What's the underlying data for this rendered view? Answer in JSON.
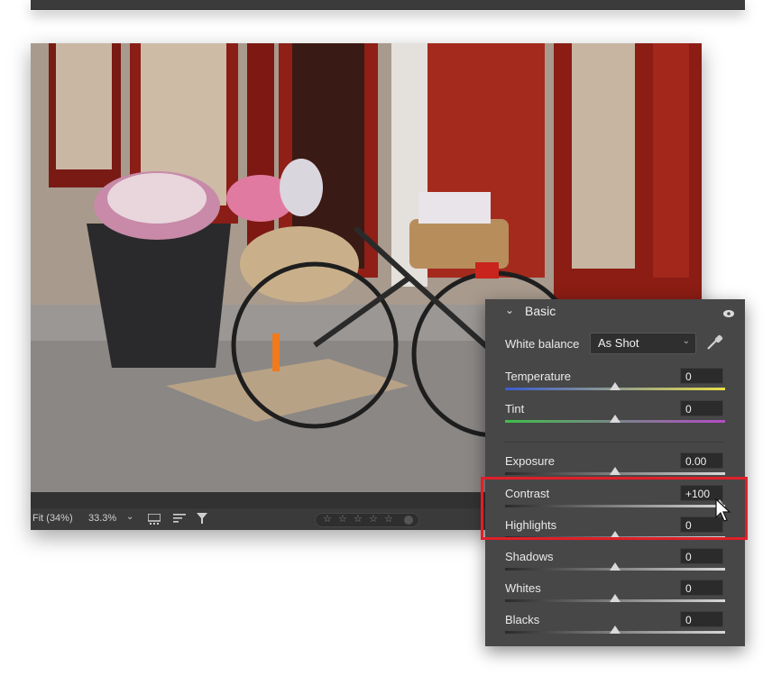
{
  "status_bar": {
    "fit_label": "Fit (34%)",
    "zoom_label": "33.3%",
    "zoom_caret": "⌄",
    "rating_stars": [
      "☆",
      "☆",
      "☆",
      "☆",
      "☆"
    ]
  },
  "basic_panel": {
    "title": "Basic",
    "chevron": "⌄",
    "white_balance_label": "White balance",
    "white_balance_value": "As Shot",
    "white_balance_caret": "⌄",
    "sliders": [
      {
        "label": "Temperature",
        "value": "0",
        "level": 0.5
      },
      {
        "label": "Tint",
        "value": "0",
        "level": 0.5
      },
      {
        "label": "Exposure",
        "value": "0.00",
        "level": 0.5
      },
      {
        "label": "Contrast",
        "value": "+100",
        "level": 1.0
      },
      {
        "label": "Highlights",
        "value": "0",
        "level": 0.5
      },
      {
        "label": "Shadows",
        "value": "0",
        "level": 0.5
      },
      {
        "label": "Whites",
        "value": "0",
        "level": 0.5
      },
      {
        "label": "Blacks",
        "value": "0",
        "level": 0.5
      }
    ]
  },
  "colors": {
    "highlight": "#e01f2a",
    "temperature_gradient": [
      "#3b5bd0",
      "#e8e04a"
    ],
    "tint_gradient": [
      "#3fbf4a",
      "#b44bc8"
    ]
  }
}
